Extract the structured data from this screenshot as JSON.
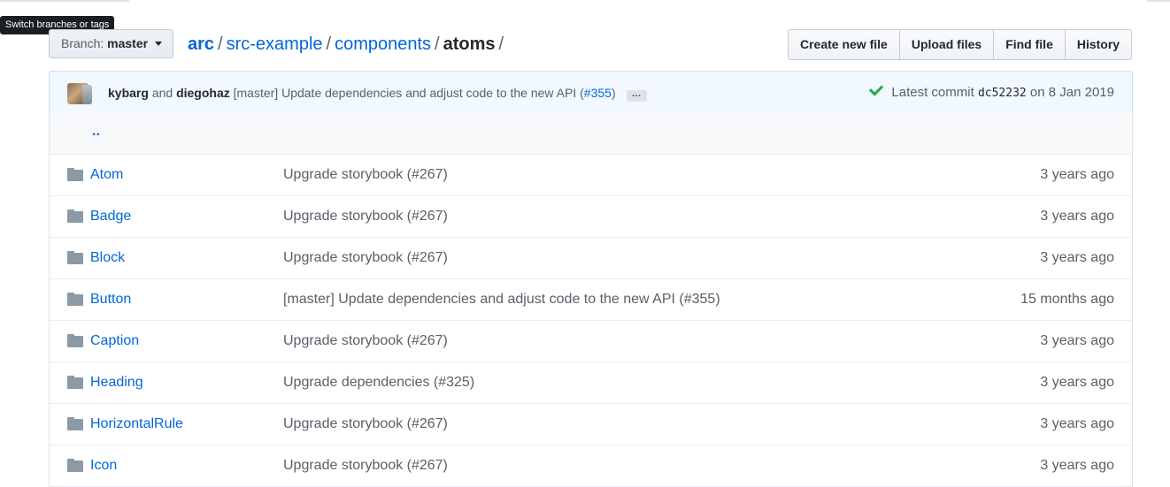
{
  "tooltip": "Switch branches or tags",
  "branch": {
    "prefix": "Branch:",
    "name": "master"
  },
  "breadcrumb": {
    "root": "arc",
    "parts": [
      "src-example",
      "components"
    ],
    "final": "atoms",
    "separator": "/"
  },
  "actions": {
    "create": "Create new file",
    "upload": "Upload files",
    "find": "Find file",
    "history": "History"
  },
  "commit": {
    "author1": "kybarg",
    "and": "and",
    "author2": "diegohaz",
    "message": "[master] Update dependencies and adjust code to the new API (",
    "pr": "#355",
    "message_end": ")",
    "ellipsis": "…",
    "latest_label": "Latest commit",
    "sha": "dc52232",
    "on": "on",
    "date": "8 Jan 2019"
  },
  "parent_dir": "..",
  "files": [
    {
      "name": "Atom",
      "message": "Upgrade storybook (#267)",
      "age": "3 years ago"
    },
    {
      "name": "Badge",
      "message": "Upgrade storybook (#267)",
      "age": "3 years ago"
    },
    {
      "name": "Block",
      "message": "Upgrade storybook (#267)",
      "age": "3 years ago"
    },
    {
      "name": "Button",
      "message": "[master] Update dependencies and adjust code to the new API (#355)",
      "age": "15 months ago"
    },
    {
      "name": "Caption",
      "message": "Upgrade storybook (#267)",
      "age": "3 years ago"
    },
    {
      "name": "Heading",
      "message": "Upgrade dependencies (#325)",
      "age": "3 years ago"
    },
    {
      "name": "HorizontalRule",
      "message": "Upgrade storybook (#267)",
      "age": "3 years ago"
    },
    {
      "name": "Icon",
      "message": "Upgrade storybook (#267)",
      "age": "3 years ago"
    }
  ],
  "colors": {
    "link": "#0366d6",
    "commit_bg": "#f1f8ff",
    "check": "#28a745",
    "folder": "#8c99a6"
  },
  "icons": {
    "folder": "folder-icon",
    "check": "check-icon",
    "caret": "caret-down-icon"
  }
}
